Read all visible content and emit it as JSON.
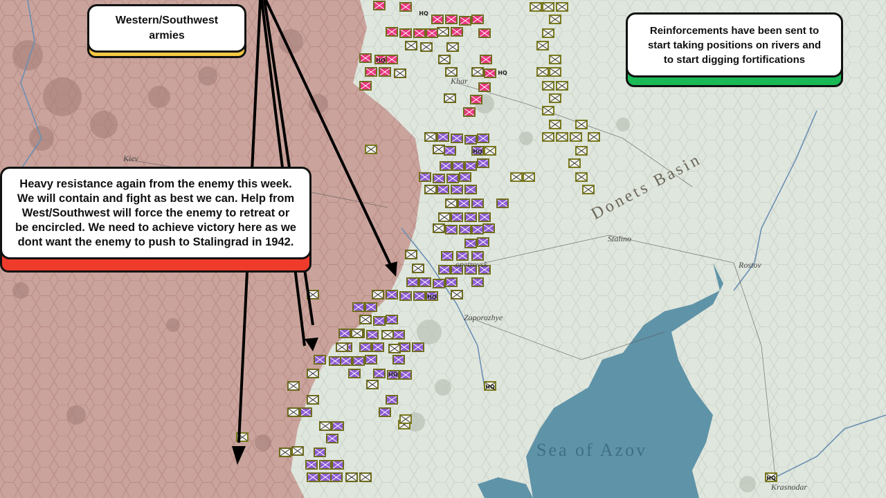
{
  "callouts": {
    "western": {
      "text": "Western/Southwest\narmies",
      "accent": "#f5c842"
    },
    "heavy": {
      "text": "Heavy resistance again from the enemy this week.\nWe will contain and fight as best we can. Help from\nWest/Southwest will force the enemy to retreat or\nbe encircled. We need to achieve victory here as we\ndont want the enemy to push to Stalingrad in 1942.",
      "accent": "#ef3b2c"
    },
    "reinforcements": {
      "text": "Reinforcements have been sent to\nstart taking positions on rivers and\nto start digging fortifications",
      "accent": "#19b955"
    }
  },
  "map": {
    "labels": {
      "kiev": "Kiev",
      "kharkov": "Khar",
      "dnipro": "opetrovsk",
      "zaporozhye": "Zaporozhye",
      "stalino": "Stalino",
      "rostov": "Rostov",
      "krasnodar": "Krasnodar",
      "donets": "Donets Basin",
      "azov": "Sea of Azov"
    },
    "colors": {
      "axis_territory": "#c9a39c",
      "soviet_territory": "#dfe6dd",
      "water": "#5f93a8",
      "axis_counter": "#7a7a1e",
      "soviet_counter_pink": "#e9357f",
      "soviet_counter_purple": "#8d5bd6"
    },
    "counter_label": "HQ"
  }
}
